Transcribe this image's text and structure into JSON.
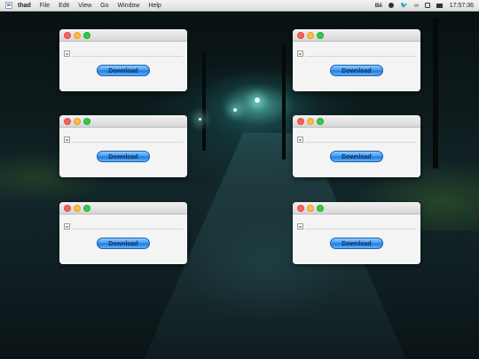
{
  "menubar": {
    "app_name": "thad",
    "menus": [
      "File",
      "Edit",
      "View",
      "Go",
      "Window",
      "Help"
    ],
    "status_icons": [
      "behance-icon",
      "dribbble-icon",
      "twitter-icon",
      "flickr-icon",
      "instagram-icon",
      "mail-icon"
    ],
    "status_glyphs": {
      "behance": "Bē",
      "twitter": "🐦",
      "flickr": "∞"
    },
    "clock": "17:57:36"
  },
  "windows": [
    {
      "button_label": "Download"
    },
    {
      "button_label": "Download"
    },
    {
      "button_label": "Download"
    },
    {
      "button_label": "Download"
    },
    {
      "button_label": "Download"
    },
    {
      "button_label": "Download"
    }
  ],
  "colors": {
    "close": "#fc605c",
    "minimize": "#fdbc40",
    "maximize": "#34c84a",
    "button_blue": "#3d96f0"
  }
}
